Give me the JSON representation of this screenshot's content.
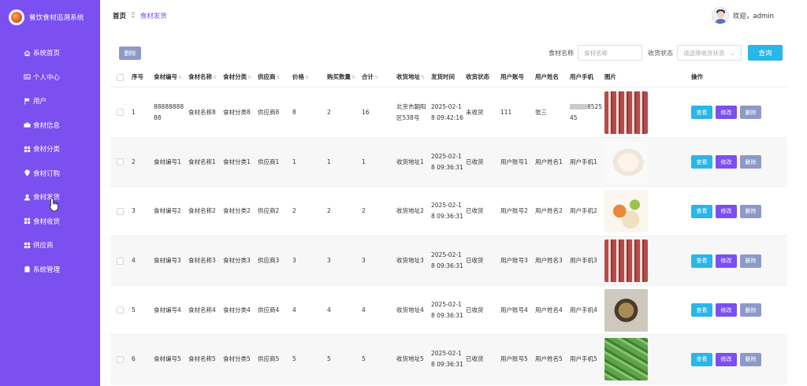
{
  "app": {
    "title": "餐饮食材追溯系统"
  },
  "sidebar": {
    "items": [
      {
        "label": "系统首页",
        "icon": "home-icon"
      },
      {
        "label": "个人中心",
        "icon": "id-card-icon"
      },
      {
        "label": "用户",
        "icon": "flag-icon"
      },
      {
        "label": "食材信息",
        "icon": "briefcase-icon"
      },
      {
        "label": "食材分类",
        "icon": "grid-icon"
      },
      {
        "label": "食材订购",
        "icon": "pin-icon"
      },
      {
        "label": "食材发货",
        "icon": "user-icon"
      },
      {
        "label": "食材收货",
        "icon": "grid-icon"
      },
      {
        "label": "供应商",
        "icon": "grid-icon"
      },
      {
        "label": "系统管理",
        "icon": "clipboard-icon"
      }
    ]
  },
  "header": {
    "breadcrumb_home": "首页",
    "breadcrumb_sep": "Ξ",
    "breadcrumb_current": "食材发货",
    "welcome": "欢迎，admin"
  },
  "toolbar": {
    "batch_delete": "删除",
    "name_label": "食材名称",
    "name_placeholder": "食材名称",
    "status_label": "收货状态",
    "status_placeholder": "请选择收货状态",
    "search": "查询"
  },
  "table": {
    "headers": [
      "序号",
      "食材编号",
      "食材名称",
      "食材分类",
      "供应商",
      "价格",
      "购买数量",
      "合计",
      "收货地址",
      "发货时间",
      "收货状态",
      "用户账号",
      "用户姓名",
      "用户手机",
      "图片",
      "操作"
    ],
    "actions": {
      "view": "查看",
      "edit": "修改",
      "delete": "删除"
    },
    "rows": [
      {
        "idx": "1",
        "code": "8888888888",
        "name": "食材名称8",
        "category": "食材分类8",
        "supplier": "供应商8",
        "price": "8",
        "qty": "2",
        "total": "16",
        "address": "北京市朝阳区538号",
        "time": "2025-02-18 09:42:16",
        "status": "未收货",
        "account": "111",
        "uname": "张三",
        "phone": "852545",
        "img": "meat"
      },
      {
        "idx": "2",
        "code": "食材编号1",
        "name": "食材名称1",
        "category": "食材分类1",
        "supplier": "供应商1",
        "price": "1",
        "qty": "1",
        "total": "1",
        "address": "收货地址1",
        "time": "2025-02-18 09:36:31",
        "status": "已收货",
        "account": "用户账号1",
        "uname": "用户姓名1",
        "phone": "用户手机1",
        "img": "fish"
      },
      {
        "idx": "3",
        "code": "食材编号2",
        "name": "食材名称2",
        "category": "食材分类2",
        "supplier": "供应商2",
        "price": "2",
        "qty": "2",
        "total": "2",
        "address": "收货地址2",
        "time": "2025-02-18 09:36:31",
        "status": "已收货",
        "account": "用户账号2",
        "uname": "用户姓名2",
        "phone": "用户手机2",
        "img": "veg"
      },
      {
        "idx": "4",
        "code": "食材编号3",
        "name": "食材名称3",
        "category": "食材分类3",
        "supplier": "供应商3",
        "price": "3",
        "qty": "3",
        "total": "3",
        "address": "收货地址3",
        "time": "2025-02-18 09:36:31",
        "status": "已收货",
        "account": "用户账号3",
        "uname": "用户姓名3",
        "phone": "用户手机3",
        "img": "meat"
      },
      {
        "idx": "5",
        "code": "食材编号4",
        "name": "食材名称4",
        "category": "食材分类4",
        "supplier": "供应商4",
        "price": "4",
        "qty": "4",
        "total": "4",
        "address": "收货地址4",
        "time": "2025-02-18 09:36:31",
        "status": "已收货",
        "account": "用户账号4",
        "uname": "用户姓名4",
        "phone": "用户手机4",
        "img": "soup"
      },
      {
        "idx": "6",
        "code": "食材编号5",
        "name": "食材名称5",
        "category": "食材分类5",
        "supplier": "供应商5",
        "price": "5",
        "qty": "5",
        "total": "5",
        "address": "收货地址5",
        "time": "2025-02-18 09:36:31",
        "status": "已收货",
        "account": "用户账号5",
        "uname": "用户姓名5",
        "phone": "用户手机5",
        "img": "peas"
      }
    ]
  },
  "colors": {
    "sidebar": "#7b4ff0",
    "view": "#29b6e8",
    "edit": "#7b4ff0",
    "delete": "#8d9ac8"
  }
}
